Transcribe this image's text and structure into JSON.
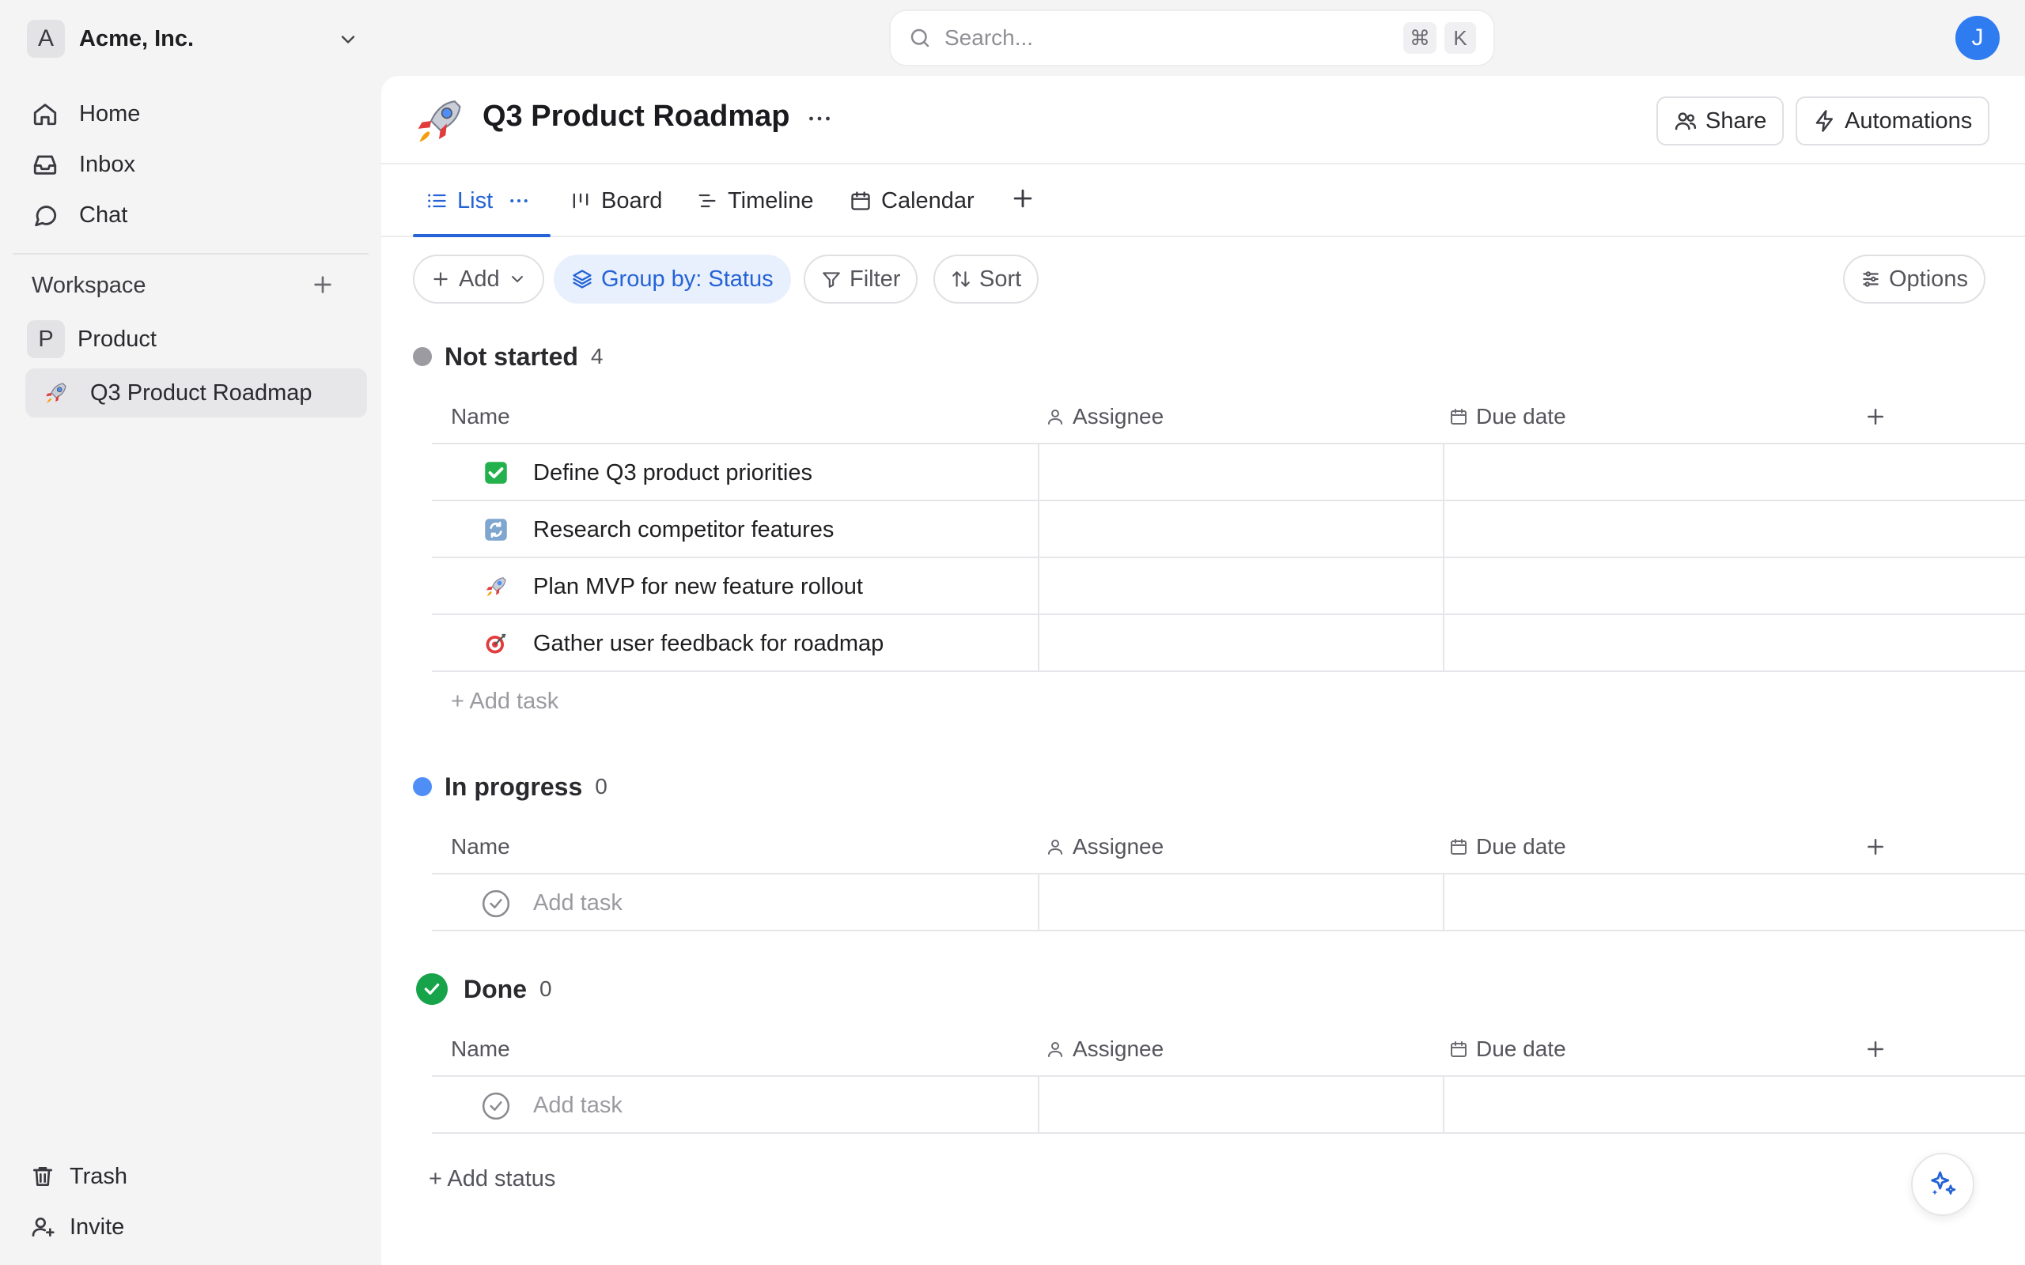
{
  "workspace_switcher": {
    "avatar_letter": "A",
    "name": "Acme, Inc."
  },
  "search": {
    "placeholder": "Search...",
    "shortcut_mod": "⌘",
    "shortcut_key": "K"
  },
  "user": {
    "avatar_letter": "J",
    "avatar_color": "#2f7bf0"
  },
  "sidebar": {
    "nav": [
      {
        "label": "Home",
        "icon": "home-icon"
      },
      {
        "label": "Inbox",
        "icon": "inbox-icon"
      },
      {
        "label": "Chat",
        "icon": "chat-icon"
      }
    ],
    "section_label": "Workspace",
    "project": {
      "avatar_letter": "P",
      "label": "Product"
    },
    "active_item": {
      "label": "Q3 Product Roadmap",
      "icon": "rocket-icon"
    },
    "bottom": [
      {
        "label": "Trash",
        "icon": "trash-icon"
      },
      {
        "label": "Invite",
        "icon": "invite-user-icon"
      }
    ]
  },
  "page": {
    "title": "Q3 Product Roadmap",
    "title_icon": "rocket-icon",
    "share_label": "Share",
    "automations_label": "Automations"
  },
  "tabs": [
    {
      "label": "List",
      "icon": "list-icon",
      "active": true
    },
    {
      "label": "Board",
      "icon": "board-icon"
    },
    {
      "label": "Timeline",
      "icon": "timeline-icon"
    },
    {
      "label": "Calendar",
      "icon": "calendar-icon"
    }
  ],
  "toolbar": {
    "add_label": "Add",
    "group_label": "Group by: Status",
    "filter_label": "Filter",
    "sort_label": "Sort",
    "options_label": "Options"
  },
  "columns": {
    "name": "Name",
    "assignee": "Assignee",
    "due_date": "Due date"
  },
  "groups": [
    {
      "title": "Not started",
      "count": "4",
      "color": "#9b9ba1",
      "tasks": [
        {
          "name": "Define Q3 product priorities",
          "icon": "check-mark-button-icon"
        },
        {
          "name": "Research competitor features",
          "icon": "refresh-arrows-icon"
        },
        {
          "name": "Plan MVP for new feature rollout",
          "icon": "rocket-icon"
        },
        {
          "name": "Gather user feedback for roadmap",
          "icon": "target-dart-icon"
        }
      ],
      "add_task_label": "+ Add task"
    },
    {
      "title": "In progress",
      "count": "0",
      "color": "#4f8ef7",
      "add_task_placeholder": "Add task"
    },
    {
      "title": "Done",
      "count": "0",
      "color": "#16a34a",
      "add_task_placeholder": "Add task"
    }
  ],
  "add_status_label": "+ Add status",
  "ai_button_icon": "sparkles-icon",
  "colors": {
    "accent": "#2563d6",
    "done": "#16a34a",
    "not_started": "#9b9ba1",
    "in_progress": "#4f8ef7"
  }
}
